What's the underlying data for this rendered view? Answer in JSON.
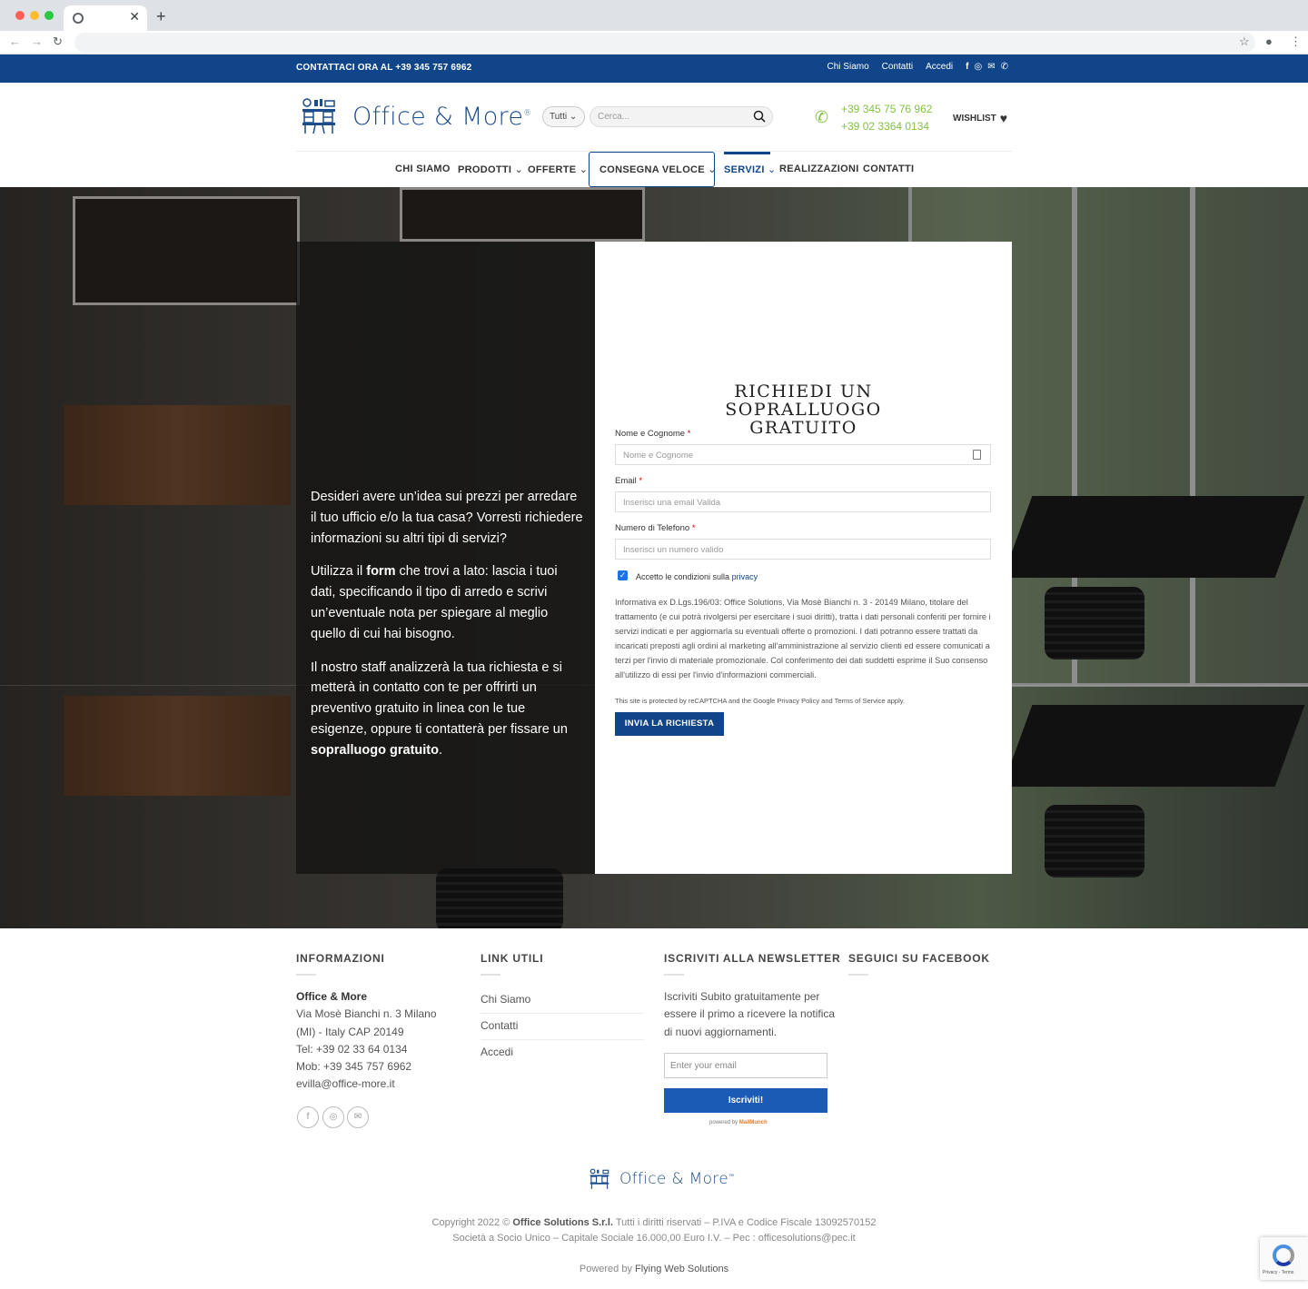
{
  "topbar": {
    "phone_text": "CONTATTACI ORA AL +39 345 757 6962",
    "links": [
      "Chi Siamo",
      "Contatti",
      "Accedi"
    ],
    "social_icons": [
      "facebook-icon",
      "instagram-icon",
      "email-icon",
      "phone-icon"
    ]
  },
  "header": {
    "logo_text": "Office & More",
    "logo_mark": "®",
    "category_select": "Tutti",
    "search_placeholder": "Cerca...",
    "phone_1": "+39 345 75 76 962",
    "phone_2": "+39 02 3364 0134",
    "wishlist_label": "WISHLIST"
  },
  "nav": {
    "items": [
      "CHI SIAMO",
      "PRODOTTI",
      "OFFERTE",
      "CONSEGNA VELOCE",
      "SERVIZI",
      "REALIZZAZIONI",
      "CONTATTI"
    ],
    "active": "SERVIZI"
  },
  "hero": {
    "left_p1": "Desideri avere un’idea sui prezzi per arredare il tuo ufficio e/o la tua casa? Vorresti richiedere informazioni su altri tipi di servizi?",
    "left_p2_a": "Utilizza il ",
    "left_p2_b": "form",
    "left_p2_c": " che trovi a lato: lascia i tuoi dati, specificando il tipo di arredo e scrivi un’eventuale nota per spiegare al meglio quello di cui hai bisogno.",
    "left_p3_a": "Il nostro staff analizzerà la tua richiesta e si metterà in contatto con te per offrirti un preventivo gratuito in linea con le tue esigenze, oppure ti contatterà per fissare un ",
    "left_p3_b": "sopralluogo gratuito",
    "left_p3_c": "."
  },
  "form": {
    "title": "RICHIEDI UN SOPRALLUOGO GRATUITO",
    "name_label": "Nome e Cognome",
    "name_placeholder": "Nome e Cognome",
    "email_label": "Email",
    "email_placeholder": "Inserisci una email Valida",
    "phone_label": "Numero di Telefono",
    "phone_placeholder": "Inserisci un numero valido",
    "required_mark": "*",
    "privacy_text": "Accetto le condizioni sulla ",
    "privacy_link": "privacy",
    "privacy_checked": true,
    "informativa": "Informativa ex D.Lgs.196/03: Office Solutions, Via Mosè Bianchi n. 3 - 20149 Milano, titolare del trattamento (e cui potrà rivolgersi per esercitare i suoi diritti), tratta i dati personali conferiti per fornire i servizi indicati e per aggiornarla su eventuali offerte o promozioni. I dati potranno essere trattati da incaricati preposti agli ordini al marketing all'amministrazione al servizio clienti ed essere comunicati a terzi per l'invio di materiale promozionale. Col conferimento dei dati suddetti esprime il Suo consenso all'utilizzo di essi per l'invio d'informazioni commerciali.",
    "recaptcha_note": "This site is protected by reCAPTCHA and the Google Privacy Policy and Terms of Service apply.",
    "submit_label": "INVIA LA RICHIESTA"
  },
  "footer": {
    "info_title": "INFORMAZIONI",
    "info_company": "Office & More",
    "info_lines": [
      "Via Mosè Bianchi n. 3 Milano",
      "(MI) - Italy CAP 20149",
      "Tel: +39 02 33 64 0134",
      "Mob: +39 345 757 6962",
      "evilla@office-more.it"
    ],
    "links_title": "LINK UTILI",
    "links": [
      "Chi Siamo",
      "Contatti",
      "Accedi"
    ],
    "newsletter_title": "ISCRIVITI ALLA NEWSLETTER",
    "newsletter_text": "Iscriviti Subito gratuitamente per essere il primo a ricevere la notifica di nuovi aggiornamenti.",
    "newsletter_placeholder": "Enter your email",
    "newsletter_button": "Iscriviti!",
    "mailmunch_prefix": "powered by ",
    "mailmunch_brand": "MailMunch",
    "facebook_title": "SEGUICI SU FACEBOOK",
    "logo_text": "Office & More",
    "logo_mark": "™",
    "copyright_a": "Copyright 2022 © ",
    "copyright_b": "Office Solutions S.r.l.",
    "copyright_c": " Tutti i diritti riservati – P.IVA e Codice Fiscale 13092570152",
    "copyright_line2": "Società a Socio Unico – Capitale Sociale 16.000,00 Euro I.V. – Pec : officesolutions@pec.it",
    "powered_a": "Powered by ",
    "powered_b": "Flying Web Solutions",
    "recaptcha_badge": "Privacy - Terms"
  },
  "colors": {
    "brand_blue": "#11458a",
    "phone_green": "#80c342",
    "newsletter_blue": "#1b5bb5"
  }
}
